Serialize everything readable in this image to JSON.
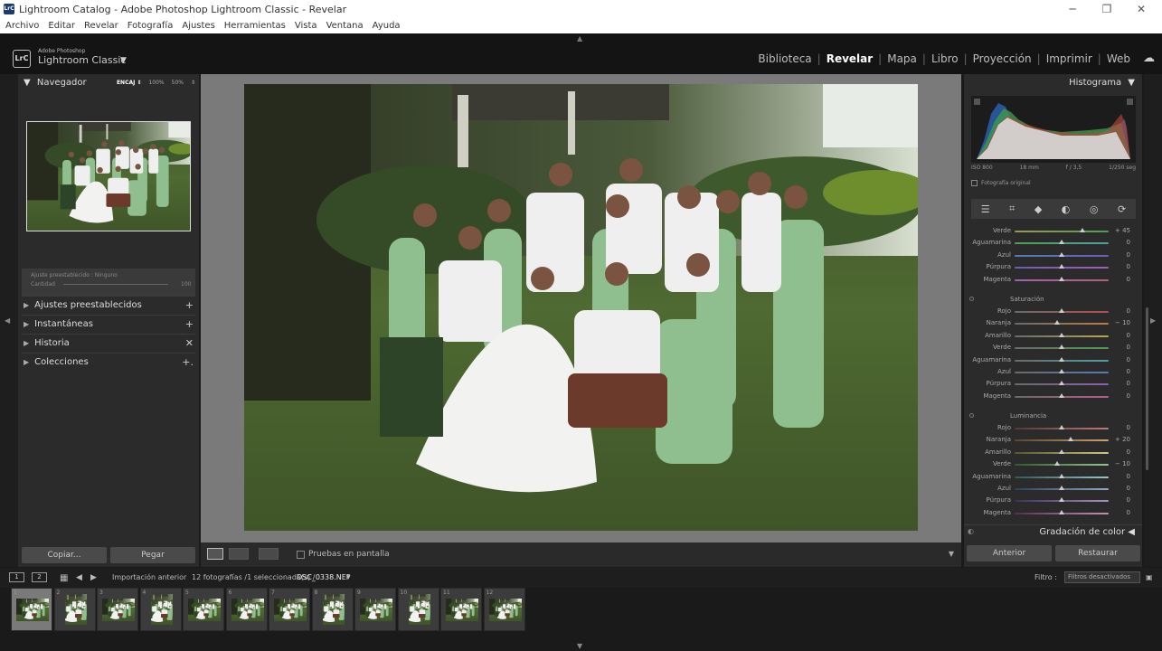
{
  "window": {
    "title": "Lightroom Catalog - Adobe Photoshop Lightroom Classic - Revelar",
    "app_icon": "LrC",
    "controls": [
      "─",
      "❐",
      "✕"
    ]
  },
  "menu": [
    "Archivo",
    "Editar",
    "Revelar",
    "Fotografía",
    "Ajustes",
    "Herramientas",
    "Vista",
    "Ventana",
    "Ayuda"
  ],
  "brand": {
    "logo": "LrC",
    "line1": "Adobe Photoshop",
    "line2": "Lightroom Classic",
    "caret": "▼"
  },
  "modules": [
    {
      "label": "Biblioteca",
      "active": false
    },
    {
      "label": "Revelar",
      "active": true
    },
    {
      "label": "Mapa",
      "active": false
    },
    {
      "label": "Libro",
      "active": false
    },
    {
      "label": "Proyección",
      "active": false
    },
    {
      "label": "Imprimir",
      "active": false
    },
    {
      "label": "Web",
      "active": false
    }
  ],
  "left": {
    "navigator": {
      "title": "Navegador",
      "toggle": "▼",
      "zoom": [
        "ENCAJ ⇕",
        "100%",
        "50%",
        "⇕"
      ]
    },
    "preset": {
      "line1": "Ajuste preestablecido : Ninguno",
      "line2": "Cantidad",
      "value": "100"
    },
    "sections": [
      {
        "label": "Ajustes preestablecidos",
        "action": "+"
      },
      {
        "label": "Instantáneas",
        "action": "+"
      },
      {
        "label": "Historia",
        "action": "✕"
      },
      {
        "label": "Colecciones",
        "action": "+."
      }
    ],
    "copy_label": "Copiar...",
    "paste_label": "Pegar"
  },
  "toolbar": {
    "proof_label": "Pruebas en pantalla"
  },
  "right": {
    "histogram_title": "Histograma",
    "histogram_meta": [
      "ISO 800",
      "18 mm",
      "f / 3,5",
      "1/250 seg"
    ],
    "original_label": "Fotografía original",
    "tools": [
      "☰",
      "⌗",
      "◆",
      "◐",
      "◎",
      "⟳"
    ],
    "hue_tail": [
      {
        "label": "Verde",
        "value": "+ 45",
        "pos": 0.72,
        "colors": [
          "#9a9a52",
          "#4f9e4f"
        ]
      },
      {
        "label": "Aguamarina",
        "value": "0",
        "pos": 0.5,
        "colors": [
          "#4f9e4f",
          "#4fa0a0"
        ]
      },
      {
        "label": "Azul",
        "value": "0",
        "pos": 0.5,
        "colors": [
          "#4f7fb3",
          "#6a5fb3"
        ]
      },
      {
        "label": "Púrpura",
        "value": "0",
        "pos": 0.5,
        "colors": [
          "#6a5fb3",
          "#a35fb3"
        ]
      },
      {
        "label": "Magenta",
        "value": "0",
        "pos": 0.5,
        "colors": [
          "#a35fb3",
          "#b35f7a"
        ]
      }
    ],
    "saturation_title": "Saturación",
    "saturation": [
      {
        "label": "Rojo",
        "value": "0",
        "pos": 0.5,
        "colors": [
          "#6a6a6a",
          "#b34f4f"
        ]
      },
      {
        "label": "Naranja",
        "value": "− 10",
        "pos": 0.45,
        "colors": [
          "#6a6a6a",
          "#c07a3a"
        ]
      },
      {
        "label": "Amarillo",
        "value": "0",
        "pos": 0.5,
        "colors": [
          "#6a6a6a",
          "#b8a84a"
        ]
      },
      {
        "label": "Verde",
        "value": "0",
        "pos": 0.5,
        "colors": [
          "#6a6a6a",
          "#4f9e4f"
        ]
      },
      {
        "label": "Aguamarina",
        "value": "0",
        "pos": 0.5,
        "colors": [
          "#6a6a6a",
          "#4fa0a0"
        ]
      },
      {
        "label": "Azul",
        "value": "0",
        "pos": 0.5,
        "colors": [
          "#6a6a6a",
          "#4f7fb3"
        ]
      },
      {
        "label": "Púrpura",
        "value": "0",
        "pos": 0.5,
        "colors": [
          "#6a6a6a",
          "#8a5fb3"
        ]
      },
      {
        "label": "Magenta",
        "value": "0",
        "pos": 0.5,
        "colors": [
          "#6a6a6a",
          "#b35f8a"
        ]
      }
    ],
    "luminance_title": "Luminancia",
    "luminance": [
      {
        "label": "Rojo",
        "value": "0",
        "pos": 0.5,
        "colors": [
          "#5a3535",
          "#c07a7a"
        ]
      },
      {
        "label": "Naranja",
        "value": "+ 20",
        "pos": 0.6,
        "colors": [
          "#5a4530",
          "#d0a070"
        ]
      },
      {
        "label": "Amarillo",
        "value": "0",
        "pos": 0.5,
        "colors": [
          "#5a5530",
          "#d0c880"
        ]
      },
      {
        "label": "Verde",
        "value": "− 10",
        "pos": 0.45,
        "colors": [
          "#2f5a2f",
          "#90c890"
        ]
      },
      {
        "label": "Aguamarina",
        "value": "0",
        "pos": 0.5,
        "colors": [
          "#2f5a5a",
          "#90c8c8"
        ]
      },
      {
        "label": "Azul",
        "value": "0",
        "pos": 0.5,
        "colors": [
          "#2f3f5a",
          "#90a8c8"
        ]
      },
      {
        "label": "Púrpura",
        "value": "0",
        "pos": 0.5,
        "colors": [
          "#3f2f5a",
          "#a890c8"
        ]
      },
      {
        "label": "Magenta",
        "value": "0",
        "pos": 0.5,
        "colors": [
          "#5a2f4a",
          "#c890b0"
        ]
      }
    ],
    "grading_title": "Gradación de color",
    "grading_arrow": "◀",
    "prev_label": "Anterior",
    "reset_label": "Restaurar"
  },
  "filmbar": {
    "monitor1": "1",
    "monitor2": "2",
    "source": "Importación anterior",
    "count": "12 fotografías /1 seleccionada(s) /",
    "filename": "DSC_0338.NEF",
    "caret": "▼",
    "filter_label": "Filtro :",
    "filter_value": "Filtros desactivados"
  },
  "filmstrip": [
    {
      "num": "1",
      "vertical": false,
      "selected": true
    },
    {
      "num": "2",
      "vertical": true,
      "selected": false
    },
    {
      "num": "3",
      "vertical": false,
      "selected": false
    },
    {
      "num": "4",
      "vertical": true,
      "selected": false
    },
    {
      "num": "5",
      "vertical": false,
      "selected": false
    },
    {
      "num": "6",
      "vertical": false,
      "selected": false
    },
    {
      "num": "7",
      "vertical": false,
      "selected": false
    },
    {
      "num": "8",
      "vertical": true,
      "selected": false
    },
    {
      "num": "9",
      "vertical": false,
      "selected": false
    },
    {
      "num": "10",
      "vertical": true,
      "selected": false
    },
    {
      "num": "11",
      "vertical": false,
      "selected": false
    },
    {
      "num": "12",
      "vertical": false,
      "selected": false
    }
  ]
}
